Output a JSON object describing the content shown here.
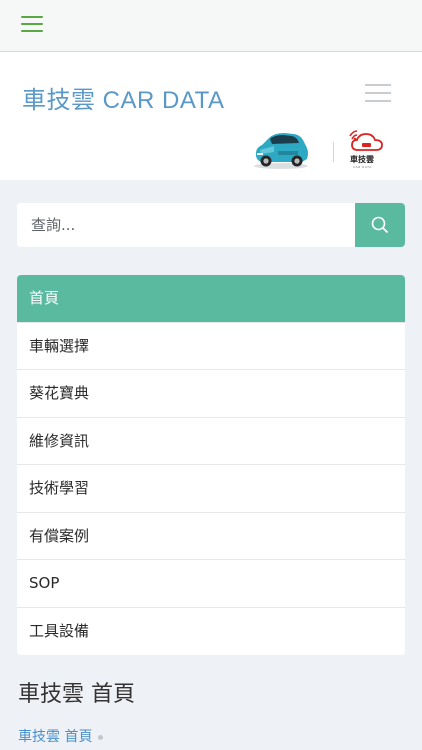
{
  "header": {
    "brand": "車技雲 CAR DATA",
    "logo_text": "車技雲",
    "logo_sub": "CAR DATA"
  },
  "search": {
    "placeholder": "查詢..."
  },
  "nav": {
    "items": [
      {
        "label": "首頁",
        "active": true
      },
      {
        "label": "車輛選擇"
      },
      {
        "label": "葵花寶典"
      },
      {
        "label": "維修資訊"
      },
      {
        "label": "技術學習"
      },
      {
        "label": "有償案例"
      },
      {
        "label": "SOP"
      },
      {
        "label": "工具設備"
      }
    ]
  },
  "page": {
    "title": "車技雲 首頁",
    "breadcrumb": "車技雲 首頁"
  },
  "colors": {
    "accent": "#5abaa0",
    "brand": "#5a98c8",
    "topbar_icon": "#5aa843",
    "background": "#eef1f6"
  },
  "icons": {
    "topbar_menu": "hamburger-icon",
    "header_menu": "menu-icon",
    "search": "search-icon",
    "car": "car-image",
    "logo": "cloud-logo"
  }
}
